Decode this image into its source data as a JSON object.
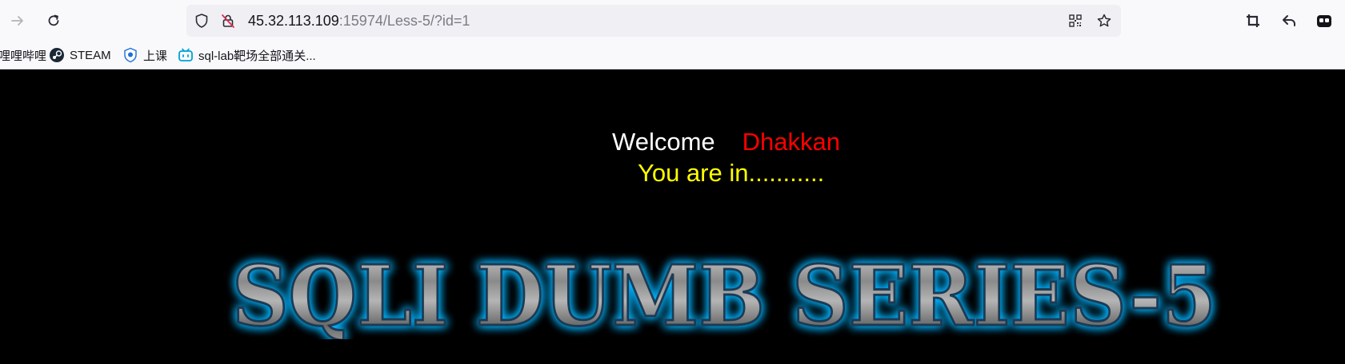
{
  "browser": {
    "url_host": "45.32.113.109",
    "url_rest": ":15974/Less-5/?id=1",
    "icons": {
      "back": "arrow-right-icon",
      "reload": "reload-icon",
      "shield": "shield-icon",
      "insecure": "insecure-lock-icon",
      "qr": "qr-code-icon",
      "bookmark_star": "star-icon",
      "screenshot": "crop-icon",
      "undo": "undo-icon",
      "extension": "extension-icon"
    }
  },
  "bookmarks": [
    {
      "label": "哩哩哔哩",
      "icon": "bilibili-icon"
    },
    {
      "label": "STEAM",
      "icon": "steam-icon"
    },
    {
      "label": "上课",
      "icon": "class-icon"
    },
    {
      "label": "sql-lab靶场全部通关...",
      "icon": "bilibili-tv-icon"
    }
  ],
  "page": {
    "welcome": "Welcome",
    "name": "Dhakkan",
    "status": "You are in...........",
    "banner_title": "SQLI DUMB SERIES-5"
  },
  "colors": {
    "background": "#000000",
    "welcome": "#ffffff",
    "name": "#ff0000",
    "status": "#ffff00",
    "banner_glow": "#00b4ff"
  }
}
